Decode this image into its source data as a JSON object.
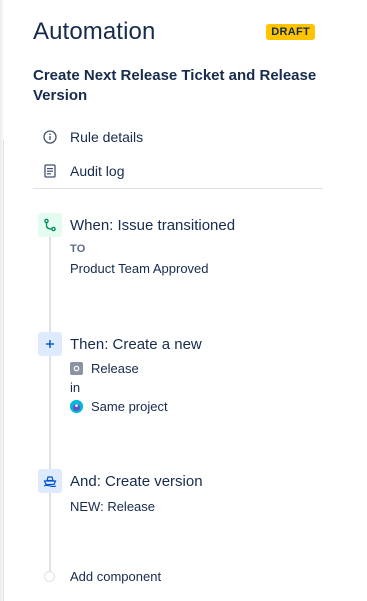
{
  "header": {
    "title": "Automation",
    "badge": "DRAFT"
  },
  "rule": {
    "name": "Create Next Release Ticket and Release Version"
  },
  "nav": {
    "items": [
      {
        "label": "Rule details",
        "icon": "info-icon"
      },
      {
        "label": "Audit log",
        "icon": "document-icon"
      }
    ]
  },
  "steps": {
    "trigger": {
      "title": "When: Issue transitioned",
      "to_label": "TO",
      "status": "Product Team Approved",
      "icon": "branch-icon"
    },
    "action1": {
      "title": "Then: Create a new",
      "issue_type": "Release",
      "in_label": "in",
      "project": "Same project",
      "icon": "plus-icon"
    },
    "action2": {
      "title": "And: Create version",
      "version": "NEW: Release",
      "icon": "ship-icon"
    }
  },
  "add_component": {
    "label": "Add component"
  },
  "colors": {
    "trigger_bg": "#e3fcef",
    "trigger_fg": "#00875a",
    "action_bg": "#deebff",
    "action_fg": "#0052cc",
    "badge_bg": "#ffc400"
  }
}
